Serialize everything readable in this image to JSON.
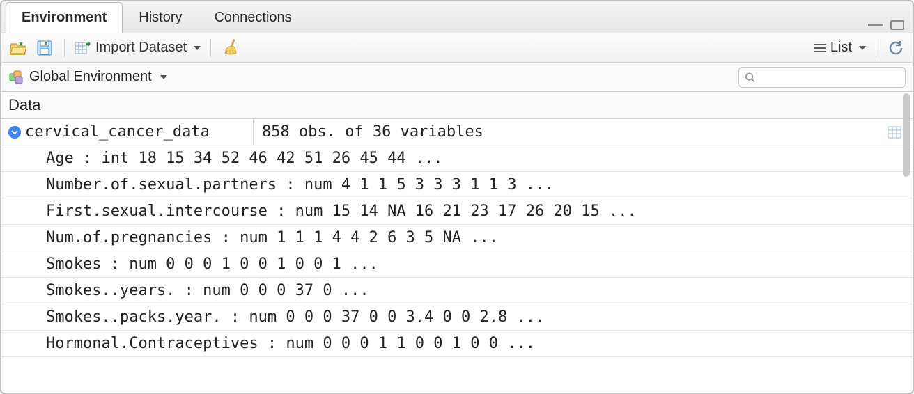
{
  "tabs": {
    "items": [
      {
        "label": "Environment",
        "active": true
      },
      {
        "label": "History",
        "active": false
      },
      {
        "label": "Connections",
        "active": false
      }
    ]
  },
  "toolbar": {
    "import_label": "Import Dataset",
    "view_mode": "List"
  },
  "env_selector": {
    "label": "Global Environment"
  },
  "data_section": {
    "heading": "Data",
    "object": {
      "name": "cervical_cancer_data",
      "summary": "858 obs. of 36 variables"
    },
    "variables": [
      "Age : int 18 15 34 52 46 42 51 26 45 44 ...",
      "Number.of.sexual.partners : num 4 1 1 5 3 3 3 1 1 3 ...",
      "First.sexual.intercourse : num 15 14 NA 16 21 23 17 26 20 15 ...",
      "Num.of.pregnancies : num 1 1 1 4 4 2 6 3 5 NA ...",
      "Smokes : num 0 0 0 1 0 0 1 0 0 1 ...",
      "Smokes..years. : num 0 0 0 37 0 ...",
      "Smokes..packs.year. : num 0 0 0 37 0 0 3.4 0 0 2.8 ...",
      "Hormonal.Contraceptives : num 0 0 0 1 1 0 0 1 0 0 ..."
    ]
  }
}
